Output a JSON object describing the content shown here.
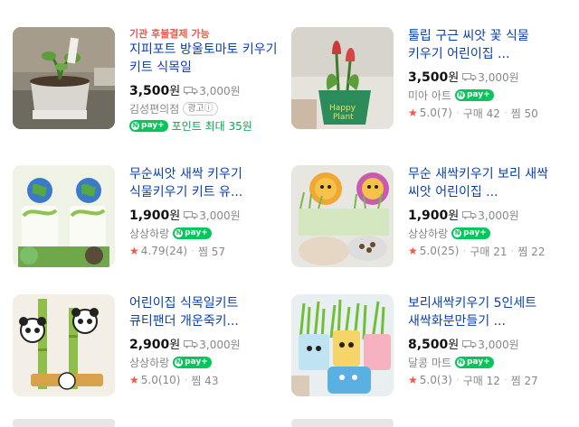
{
  "products": [
    {
      "badge": "기관 후불결제 가능",
      "title": "지피포트 방울토마토 키우기 키트 식목일",
      "price": "3,500",
      "won": "원",
      "shipping": "3,000원",
      "seller": "김성편의점",
      "ad": "광고",
      "npay": "pay+",
      "point": "포인트 최대 35원",
      "thumb_icon": "tomato-pot-photo"
    },
    {
      "title": "툴립 구근 씨앗 꽃 식물 키우기 어린이집 ...",
      "price": "3,500",
      "won": "원",
      "shipping": "3,000원",
      "seller": "미아 아트",
      "npay": "pay+",
      "rating": "5.0",
      "reviews": "(7)",
      "purchases": "구매 42",
      "likes": "찜 50",
      "thumb_icon": "tulip-pot-photo"
    },
    {
      "title": "무순씨앗 새싹 키우기 식물키우기 키트 유...",
      "price": "1,900",
      "won": "원",
      "shipping": "3,000원",
      "seller": "상상하랑",
      "npay": "pay+",
      "rating": "4.79",
      "reviews": "(24)",
      "likes": "찜 57",
      "thumb_icon": "earth-sprout-kit-photo"
    },
    {
      "title": "무순 새싹키우기 보리 새싹 씨앗 어린이집 ...",
      "price": "1,900",
      "won": "원",
      "shipping": "3,000원",
      "seller": "상상하랑",
      "npay": "pay+",
      "rating": "5.0",
      "reviews": "(25)",
      "purchases": "구매 21",
      "likes": "찜 22",
      "thumb_icon": "lion-sprout-cups-photo"
    },
    {
      "title": "어린이집 식목일키트 큐티팬더 개운죽키...",
      "price": "2,900",
      "won": "원",
      "shipping": "3,000원",
      "seller": "상상하랑",
      "npay": "pay+",
      "rating": "5.0",
      "reviews": "(10)",
      "likes": "찜 43",
      "thumb_icon": "panda-bamboo-photo"
    },
    {
      "title": "보리새싹키우기 5인세트 새싹화분만들기 ...",
      "price": "8,500",
      "won": "원",
      "shipping": "3,000원",
      "seller": "달콩 마트",
      "npay": "pay+",
      "rating": "5.0",
      "reviews": "(3)",
      "purchases": "구매 12",
      "likes": "찜 27",
      "thumb_icon": "barley-grass-cups-photo"
    }
  ],
  "colors": {
    "title": "#0a3fb0",
    "badge": "#f2574a",
    "npay": "#03c75a",
    "star": "#f2574a",
    "muted": "#888888"
  }
}
